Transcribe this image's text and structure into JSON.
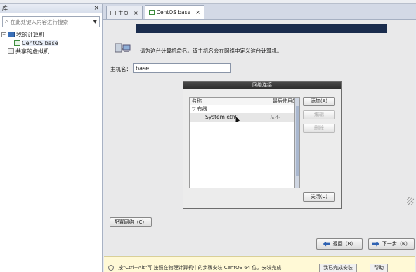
{
  "library": {
    "title": "库",
    "close_label": "×",
    "search_placeholder": "在此处键入内容进行搜索",
    "tree": [
      {
        "label": "我的计算机",
        "expand": "−"
      },
      {
        "label": "CentOS base"
      },
      {
        "label": "共享的虚拟机"
      }
    ]
  },
  "tabs": [
    {
      "label": "主页",
      "close": "×"
    },
    {
      "label": "CentOS base",
      "close": "×"
    }
  ],
  "installer": {
    "description": "请为这台计算机命名。该主机名会在网络中定义这台计算机。",
    "hostname_label": "主机名：",
    "hostname_value": "base",
    "configure_network_label": "配置网络（C）",
    "back_label": "返回（B）",
    "next_label": "下一步（N）"
  },
  "dialog": {
    "title": "网络连接",
    "columns": [
      "名称",
      "最后使用的"
    ],
    "group": "有线",
    "group_toggle": "▽",
    "rows": [
      {
        "name": "System eth0",
        "last_used": "从不"
      }
    ],
    "add_label": "添加(A)",
    "edit_label": "编辑",
    "delete_label": "删除",
    "close_label": "关闭(C)"
  },
  "statusbar": {
    "message": "按\"Ctrl+Alt\"可   按照在物理计算机中的步骤安装 CentOS 64 位。安装完成",
    "done_button": "我已完成安装",
    "help_button": "帮助"
  }
}
